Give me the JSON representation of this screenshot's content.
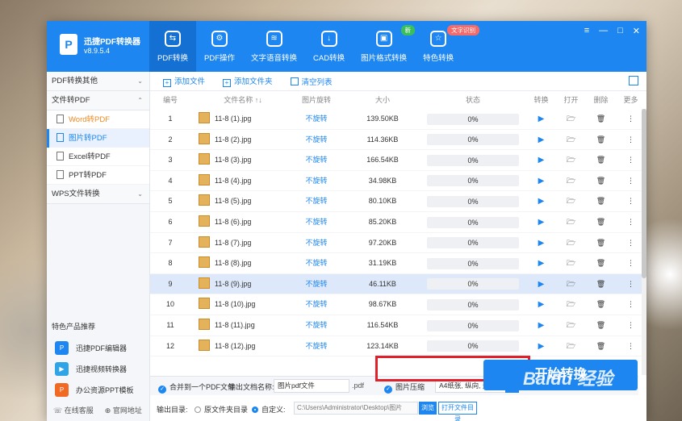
{
  "app": {
    "name": "迅捷PDF转换器",
    "version": "v8.9.5.4"
  },
  "nav": [
    {
      "label": "PDF转换",
      "icon": "convert-icon",
      "glyph": "⇆"
    },
    {
      "label": "PDF操作",
      "icon": "gear-icon",
      "glyph": "⚙"
    },
    {
      "label": "文字语音转换",
      "icon": "audio-wave-icon",
      "glyph": "≋"
    },
    {
      "label": "CAD转换",
      "icon": "cad-icon",
      "glyph": "↓"
    },
    {
      "label": "图片格式转换",
      "icon": "image-icon",
      "glyph": "▣",
      "badge": "新"
    },
    {
      "label": "特色转换",
      "icon": "star-icon",
      "glyph": "☆",
      "badge": "文字识别"
    }
  ],
  "window_controls": [
    "≡",
    "—",
    "□",
    "✕"
  ],
  "sidebar": {
    "groups": [
      {
        "label": "PDF转换其他",
        "chev": "⌄"
      },
      {
        "label": "文件转PDF",
        "chev": "⌃"
      },
      {
        "label": "WPS文件转换",
        "chev": "⌄"
      }
    ],
    "subs": [
      "Word转PDF",
      "图片转PDF",
      "Excel转PDF",
      "PPT转PDF"
    ],
    "featured_title": "特色产品推荐",
    "featured": [
      "迅捷PDF编辑器",
      "迅捷视频转换器",
      "办公资源PPT模板"
    ],
    "footer": [
      "在线客服",
      "官网地址"
    ]
  },
  "toolbar": {
    "add_file": "添加文件",
    "add_folder": "添加文件夹",
    "clear": "清空列表"
  },
  "table": {
    "headers": [
      "编号",
      "文件名称",
      "图片旋转",
      "大小",
      "状态",
      "转换",
      "打开",
      "删除",
      "更多"
    ],
    "sort_glyph": "↑↓",
    "rotate_label": "不旋转",
    "rows": [
      {
        "num": "1",
        "name": "11-8 (1).jpg",
        "size": "139.50KB",
        "status": "0%"
      },
      {
        "num": "2",
        "name": "11-8 (2).jpg",
        "size": "114.36KB",
        "status": "0%"
      },
      {
        "num": "3",
        "name": "11-8 (3).jpg",
        "size": "166.54KB",
        "status": "0%"
      },
      {
        "num": "4",
        "name": "11-8 (4).jpg",
        "size": "34.98KB",
        "status": "0%"
      },
      {
        "num": "5",
        "name": "11-8 (5).jpg",
        "size": "80.10KB",
        "status": "0%"
      },
      {
        "num": "6",
        "name": "11-8 (6).jpg",
        "size": "85.20KB",
        "status": "0%"
      },
      {
        "num": "7",
        "name": "11-8 (7).jpg",
        "size": "97.20KB",
        "status": "0%"
      },
      {
        "num": "8",
        "name": "11-8 (8).jpg",
        "size": "31.19KB",
        "status": "0%"
      },
      {
        "num": "9",
        "name": "11-8 (9).jpg",
        "size": "46.11KB",
        "status": "0%"
      },
      {
        "num": "10",
        "name": "11-8 (10).jpg",
        "size": "98.67KB",
        "status": "0%"
      },
      {
        "num": "11",
        "name": "11-8 (11).jpg",
        "size": "116.54KB",
        "status": "0%"
      },
      {
        "num": "12",
        "name": "11-8 (12).jpg",
        "size": "123.14KB",
        "status": "0%"
      }
    ],
    "selected_row": "9"
  },
  "options": {
    "merge": "合并到一个PDF文件",
    "filename_label": "输出文档名称:",
    "filename_value": "图片pdf文件",
    "ext": ".pdf",
    "compress": "图片压缩",
    "page_setting": "A4纸张, 纵向, 无边距"
  },
  "output": {
    "label": "输出目录:",
    "opt_original": "原文件夹目录",
    "opt_custom": "自定义:",
    "path": "C:\\Users\\Administrator\\Desktop\\图片",
    "browse": "浏览",
    "open_folder": "打开文件目录"
  },
  "start_button": "开始转换",
  "watermark": "Baidu 经验",
  "watermark_sub": "jingyan.baidu.com"
}
